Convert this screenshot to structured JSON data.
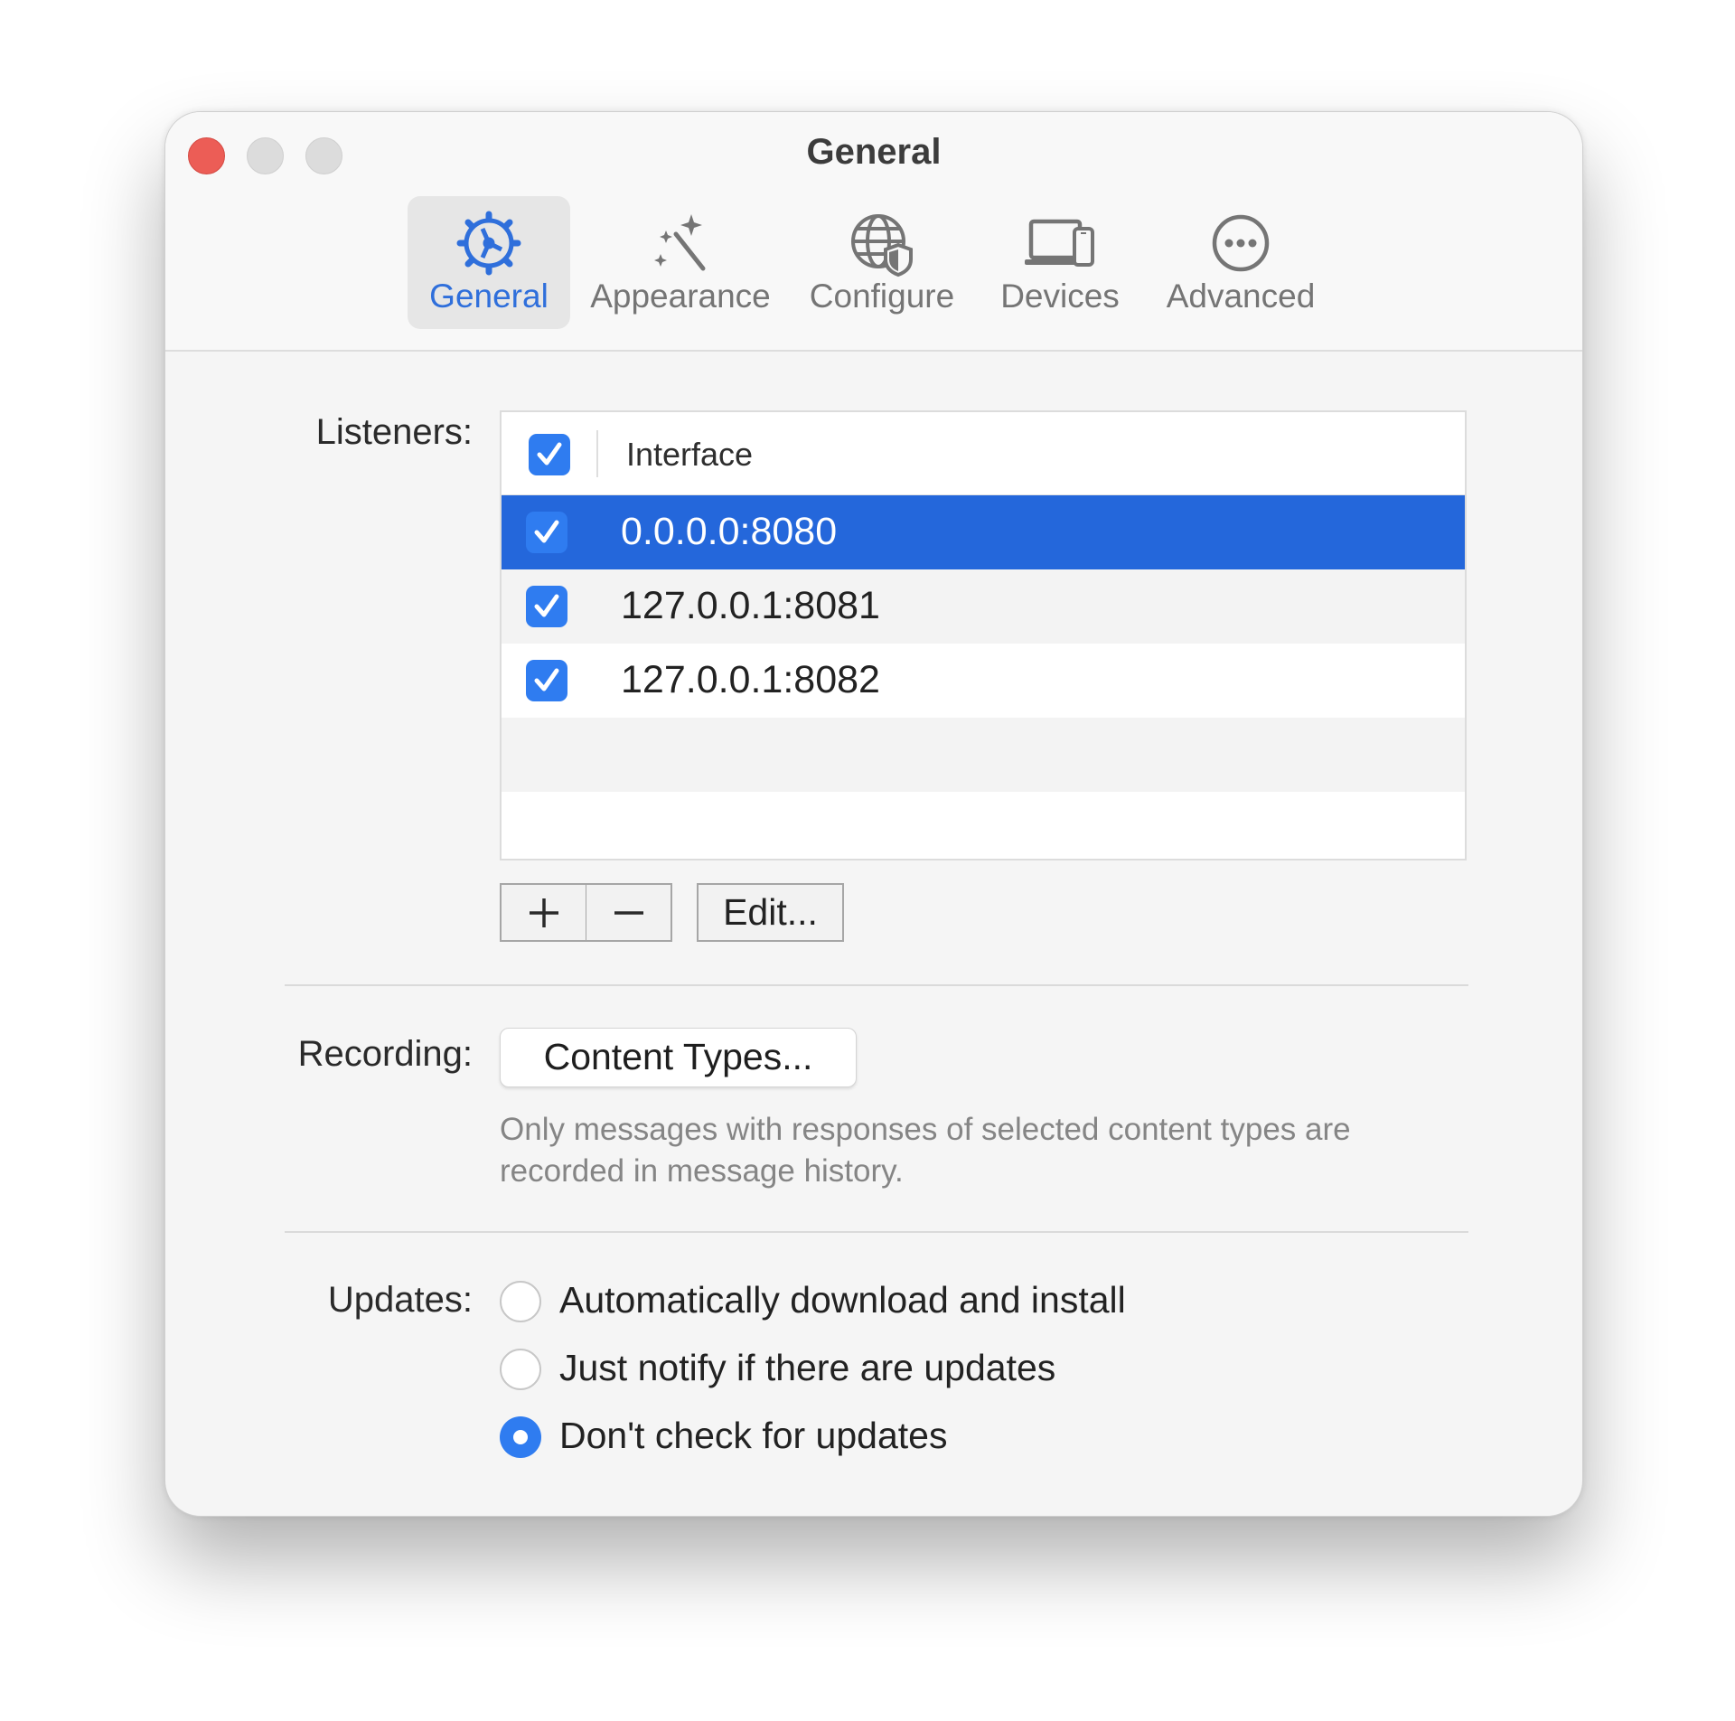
{
  "window": {
    "title": "General"
  },
  "toolbar": {
    "tabs": [
      {
        "label": "General",
        "icon": "gear-icon",
        "active": true
      },
      {
        "label": "Appearance",
        "icon": "magic-wand-icon",
        "active": false
      },
      {
        "label": "Configure",
        "icon": "globe-shield-icon",
        "active": false
      },
      {
        "label": "Devices",
        "icon": "devices-icon",
        "active": false
      },
      {
        "label": "Advanced",
        "icon": "ellipsis-circle-icon",
        "active": false
      }
    ]
  },
  "listeners": {
    "label": "Listeners:",
    "column_header": "Interface",
    "header_checked": true,
    "rows": [
      {
        "interface": "0.0.0.0:8080",
        "checked": true,
        "selected": true
      },
      {
        "interface": "127.0.0.1:8081",
        "checked": true,
        "selected": false
      },
      {
        "interface": "127.0.0.1:8082",
        "checked": true,
        "selected": false
      }
    ],
    "add_label": "+",
    "remove_label": "—",
    "edit_label": "Edit..."
  },
  "recording": {
    "label": "Recording:",
    "button_label": "Content Types...",
    "hint": "Only messages with responses of selected content types are recorded in message history."
  },
  "updates": {
    "label": "Updates:",
    "options": [
      {
        "label": "Automatically download and install",
        "selected": false
      },
      {
        "label": "Just notify if there are updates",
        "selected": false
      },
      {
        "label": "Don't check for updates",
        "selected": true
      }
    ]
  },
  "colors": {
    "accent": "#2f7cf0",
    "selection": "#2467db",
    "active_tab_text": "#2f6fdb",
    "close_button": "#ec5d56"
  }
}
